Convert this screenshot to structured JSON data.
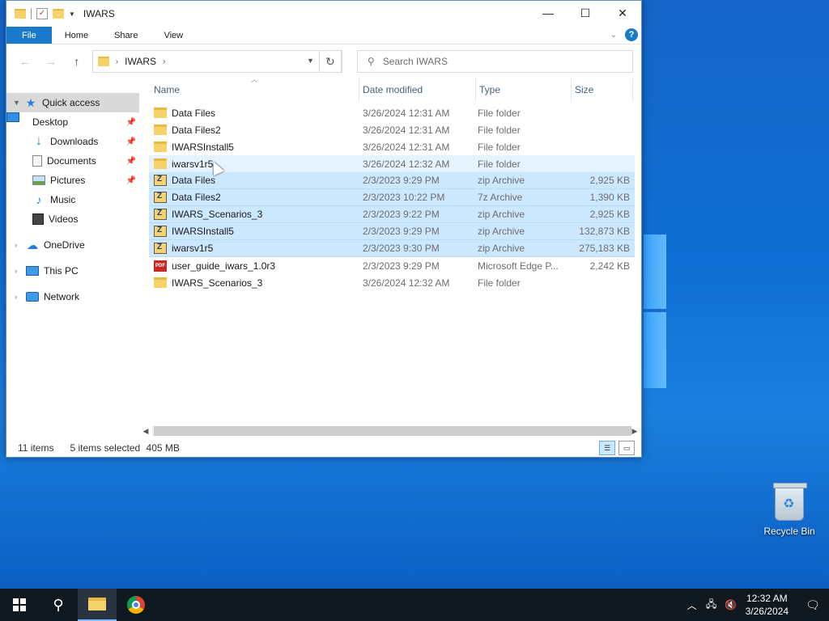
{
  "window": {
    "title": "IWARS",
    "controls": {
      "minimize": "—",
      "maximize": "☐",
      "close": "✕"
    }
  },
  "ribbon": {
    "tabs": [
      "File",
      "Home",
      "Share",
      "View"
    ],
    "help": "?"
  },
  "address": {
    "crumbs": [
      "IWARS"
    ],
    "search_placeholder": "Search IWARS"
  },
  "nav": {
    "quick_access": "Quick access",
    "quick_items": [
      {
        "label": "Desktop",
        "icon": "desktop-icon",
        "pinned": true
      },
      {
        "label": "Downloads",
        "icon": "downloads-icon",
        "pinned": true
      },
      {
        "label": "Documents",
        "icon": "documents-icon",
        "pinned": true
      },
      {
        "label": "Pictures",
        "icon": "pictures-icon",
        "pinned": true
      },
      {
        "label": "Music",
        "icon": "music-icon",
        "pinned": false
      },
      {
        "label": "Videos",
        "icon": "videos-icon",
        "pinned": false
      }
    ],
    "onedrive": "OneDrive",
    "this_pc": "This PC",
    "network": "Network"
  },
  "columns": {
    "name": "Name",
    "date": "Date modified",
    "type": "Type",
    "size": "Size"
  },
  "files": [
    {
      "name": "Data Files",
      "date": "3/26/2024 12:31 AM",
      "type": "File folder",
      "size": "",
      "icon": "folder",
      "state": ""
    },
    {
      "name": "Data Files2",
      "date": "3/26/2024 12:31 AM",
      "type": "File folder",
      "size": "",
      "icon": "folder",
      "state": ""
    },
    {
      "name": "IWARSInstall5",
      "date": "3/26/2024 12:31 AM",
      "type": "File folder",
      "size": "",
      "icon": "folder",
      "state": ""
    },
    {
      "name": "iwarsv1r5",
      "date": "3/26/2024 12:32 AM",
      "type": "File folder",
      "size": "",
      "icon": "folder",
      "state": "hover"
    },
    {
      "name": "Data Files",
      "date": "2/3/2023 9:29 PM",
      "type": "zip Archive",
      "size": "2,925 KB",
      "icon": "zip",
      "state": "selected"
    },
    {
      "name": "Data Files2",
      "date": "2/3/2023 10:22 PM",
      "type": "7z Archive",
      "size": "1,390 KB",
      "icon": "zip",
      "state": "selected"
    },
    {
      "name": "IWARS_Scenarios_3",
      "date": "2/3/2023 9:22 PM",
      "type": "zip Archive",
      "size": "2,925 KB",
      "icon": "zip",
      "state": "selected"
    },
    {
      "name": "IWARSInstall5",
      "date": "2/3/2023 9:29 PM",
      "type": "zip Archive",
      "size": "132,873 KB",
      "icon": "zip",
      "state": "selected"
    },
    {
      "name": "iwarsv1r5",
      "date": "2/3/2023 9:30 PM",
      "type": "zip Archive",
      "size": "275,183 KB",
      "icon": "zip",
      "state": "selected"
    },
    {
      "name": "user_guide_iwars_1.0r3",
      "date": "2/3/2023 9:29 PM",
      "type": "Microsoft Edge P...",
      "size": "2,242 KB",
      "icon": "pdf",
      "state": ""
    },
    {
      "name": "IWARS_Scenarios_3",
      "date": "3/26/2024 12:32 AM",
      "type": "File folder",
      "size": "",
      "icon": "folder",
      "state": ""
    }
  ],
  "status": {
    "count": "11 items",
    "selected": "5 items selected",
    "size": "405 MB"
  },
  "desktop": {
    "recycle_bin": "Recycle Bin"
  },
  "taskbar": {
    "time": "12:32 AM",
    "date": "3/26/2024"
  },
  "colors": {
    "accent": "#1979ca",
    "selected_row": "#cce8ff",
    "taskbar": "#101820"
  }
}
